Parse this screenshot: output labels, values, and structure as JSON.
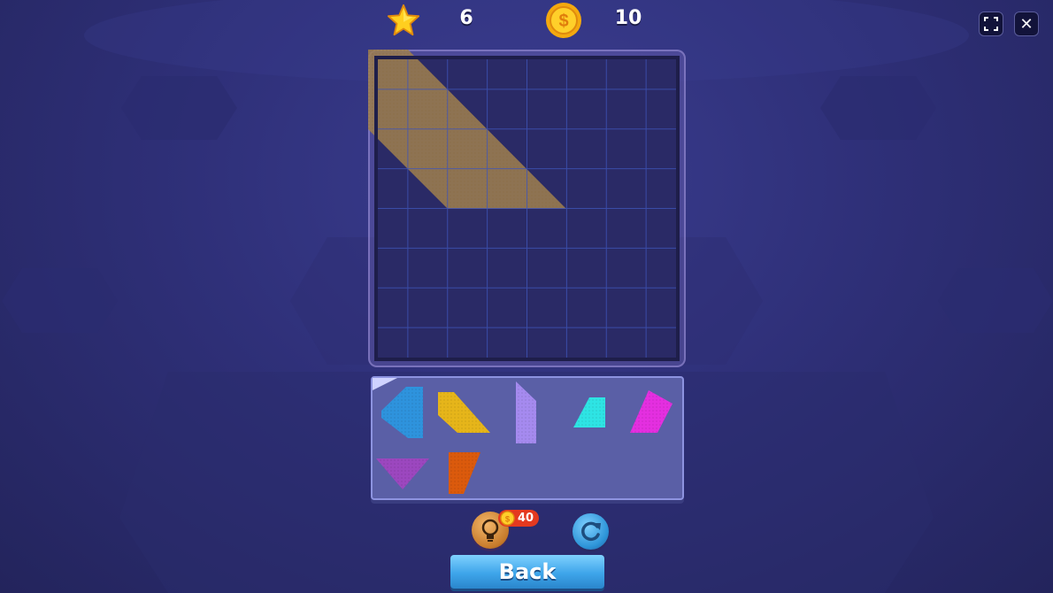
{
  "hud": {
    "star_icon": "star-icon",
    "stars": "6",
    "coin_icon": "coin-icon",
    "coins": "10"
  },
  "window_controls": {
    "fullscreen_icon": "fullscreen-icon",
    "close_icon": "close-icon",
    "close_glyph": "✕"
  },
  "board": {
    "rows": 8,
    "cols": 8,
    "target_color": "#a0804f"
  },
  "tray": {
    "pieces": [
      {
        "name": "blue-piece",
        "color": "#2e93dd"
      },
      {
        "name": "yellow-piece",
        "color": "#e6b51a"
      },
      {
        "name": "lavender-piece",
        "color": "#a58aef"
      },
      {
        "name": "cyan-piece",
        "color": "#2ee4e4"
      },
      {
        "name": "magenta-piece",
        "color": "#e42fe0"
      },
      {
        "name": "purple-piece",
        "color": "#9c47bf"
      },
      {
        "name": "orange-piece",
        "color": "#db5a0c"
      }
    ]
  },
  "controls": {
    "hint_icon": "lightbulb-icon",
    "hint_cost": "40",
    "reset_icon": "refresh-icon",
    "back_label": "Back"
  }
}
